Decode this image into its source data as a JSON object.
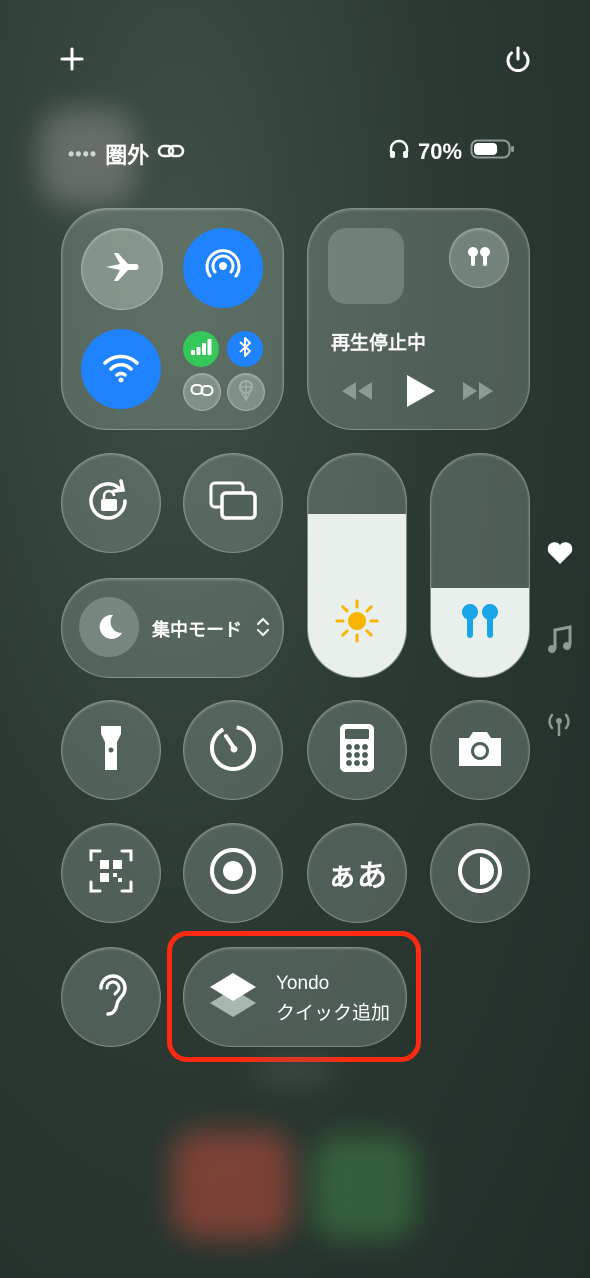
{
  "status": {
    "carrier": "圏外",
    "battery_percent": "70%",
    "battery_level": 0.7
  },
  "media": {
    "now_playing": "再生停止中"
  },
  "focus": {
    "label": "集中モード"
  },
  "brightness": {
    "level": 0.73
  },
  "volume": {
    "level": 0.4
  },
  "text_size": {
    "label": "ぁあ"
  },
  "shortcut": {
    "title": "Yondo",
    "subtitle": "クイック追加"
  },
  "icons": [
    "plus-icon",
    "power-icon",
    "link-icon",
    "headphones-icon",
    "battery-icon",
    "airplane-icon",
    "airdrop-icon",
    "wifi-icon",
    "cellular-icon",
    "bluetooth-icon",
    "personal-hotspot-icon",
    "vpn-icon",
    "airpods-icon",
    "rewind-icon",
    "play-icon",
    "fast-forward-icon",
    "rotation-lock-icon",
    "screen-mirroring-icon",
    "moon-icon",
    "sun-icon",
    "flashlight-icon",
    "timer-icon",
    "calculator-icon",
    "camera-icon",
    "qr-code-icon",
    "screen-record-icon",
    "dark-mode-icon",
    "hearing-icon",
    "shortcuts-icon",
    "heart-icon",
    "music-note-icon",
    "antenna-icon"
  ]
}
